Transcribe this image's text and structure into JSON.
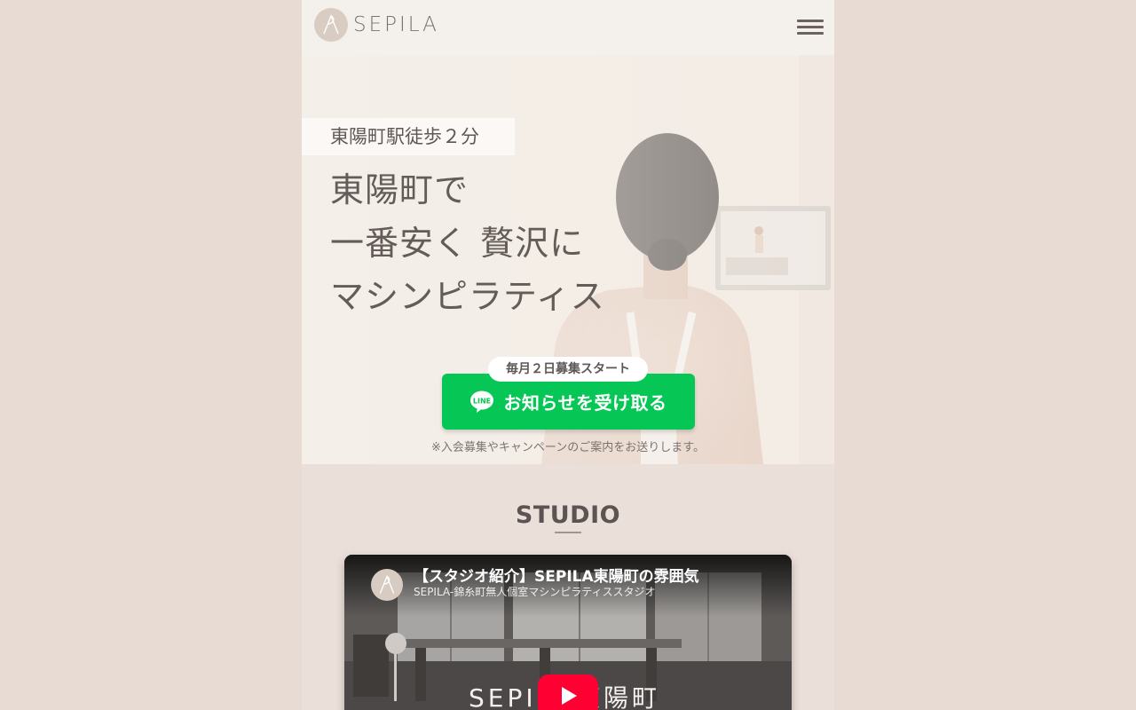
{
  "header": {
    "logo_text": "SEPILA",
    "menu_icon": "hamburger-icon"
  },
  "hero": {
    "access": "東陽町駅徒歩２分",
    "title_lines": [
      "東陽町で",
      "一番安く 贅沢に",
      "マシンピラティス"
    ],
    "cta_note": "毎月２日募集スタート",
    "cta_label": "お知らせを受け取る",
    "cta_icon": "line-icon",
    "cta_sub": "※入会募集やキャンペーンのご案内をお送りします。"
  },
  "studio": {
    "heading": "STUDIO",
    "video": {
      "title": "【スタジオ紹介】SEPILA東陽町の雰囲気",
      "channel": "SEPILA-錦糸町無人個室マシンピラティススタジオ",
      "overlay_text": "SEPILA東陽町",
      "play_icon": "play-icon"
    }
  },
  "colors": {
    "line_green": "#06c755",
    "youtube_red": "#ff0033",
    "background": "#e7dbd3"
  }
}
